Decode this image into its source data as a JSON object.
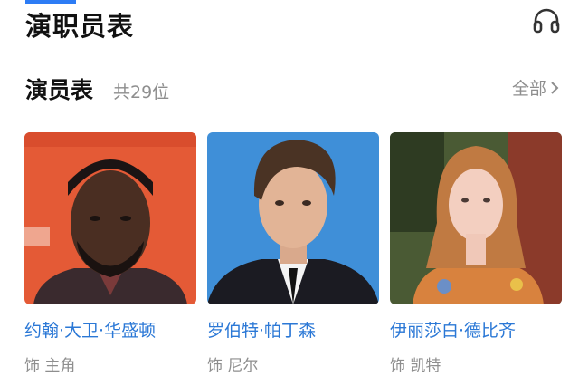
{
  "header": {
    "title": "演职员表",
    "icon": "headphones-icon"
  },
  "section": {
    "title": "演员表",
    "count": "共29位",
    "see_all": "全部"
  },
  "cast": [
    {
      "name": "约翰·大卫·华盛顿",
      "role": "饰 主角"
    },
    {
      "name": "罗伯特·帕丁森",
      "role": "饰 尼尔"
    },
    {
      "name": "伊丽莎白·德比齐",
      "role": "饰 凯特"
    }
  ],
  "colors": {
    "accent": "#2d7cf5",
    "name_link": "#2b78d6",
    "muted": "#8e8e8e"
  }
}
